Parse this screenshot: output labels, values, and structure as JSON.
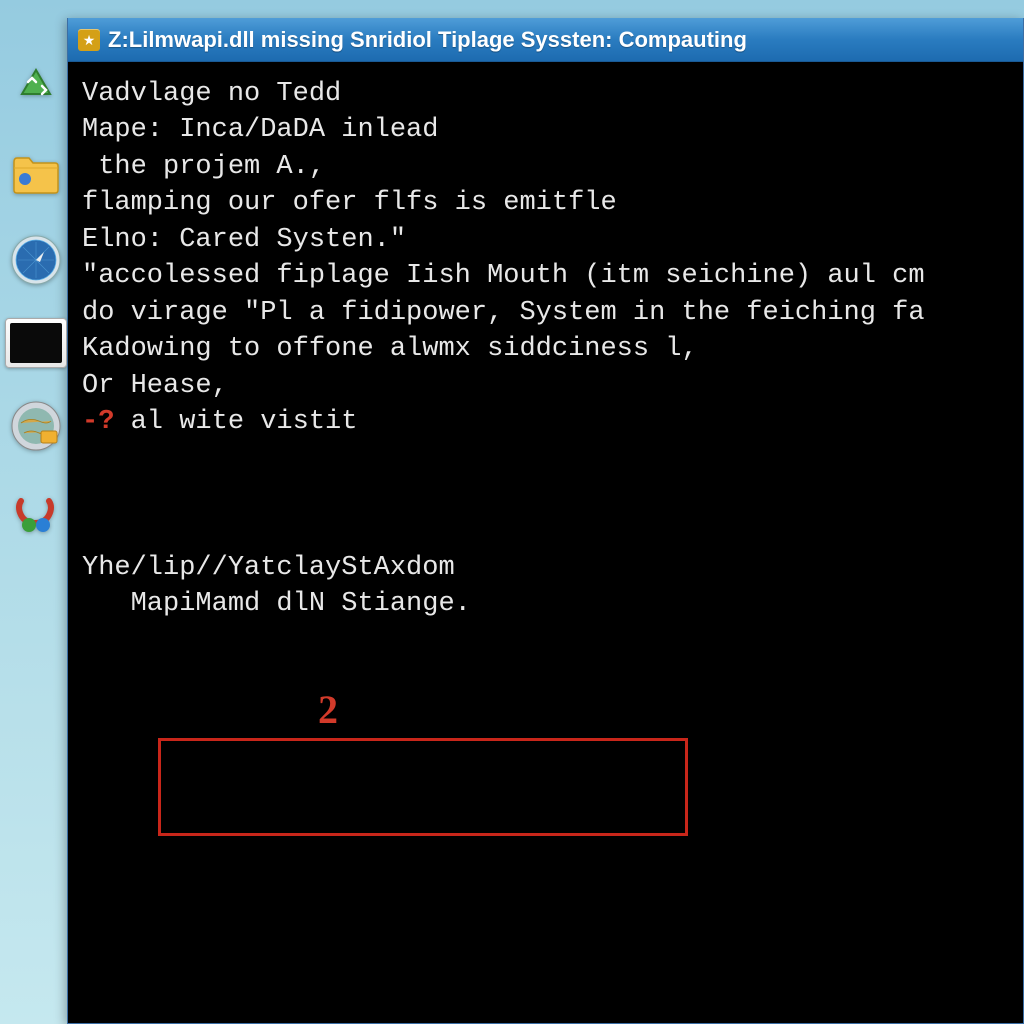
{
  "titlebar": {
    "text": "Z:Lilmwapi.dll missing Snridiol Tiplage Syssten: Compauting"
  },
  "desktop_icons": [
    {
      "name": "recycle-icon"
    },
    {
      "name": "folder-icon"
    },
    {
      "name": "safari-icon"
    },
    {
      "name": "monitor-icon"
    },
    {
      "name": "settings-globe-icon"
    },
    {
      "name": "tool-icon"
    }
  ],
  "terminal": {
    "lines": [
      "Vadvlage no Tedd",
      "",
      "Mape: Inca/DaDA inlead",
      " the projem A.,",
      "flamping our ofer flfs is emitfle",
      "Elno: Cared Systen.\"",
      "",
      "\"accolessed fiplage Iish Mouth (itm seichine) aul cm",
      "do virage \"Pl a fidipower, System in the feiching fa",
      "Kadowing to offone alwmx siddciness l,",
      "",
      "",
      "Or Hease,"
    ],
    "prompt_marker": "-?",
    "prompt_text": " al wite vistit",
    "highlight_block": [
      "Yhe/lip//YatclayStAxdom",
      "   MapiMamd dlN Stiange."
    ]
  },
  "annotation": {
    "number": "2"
  }
}
